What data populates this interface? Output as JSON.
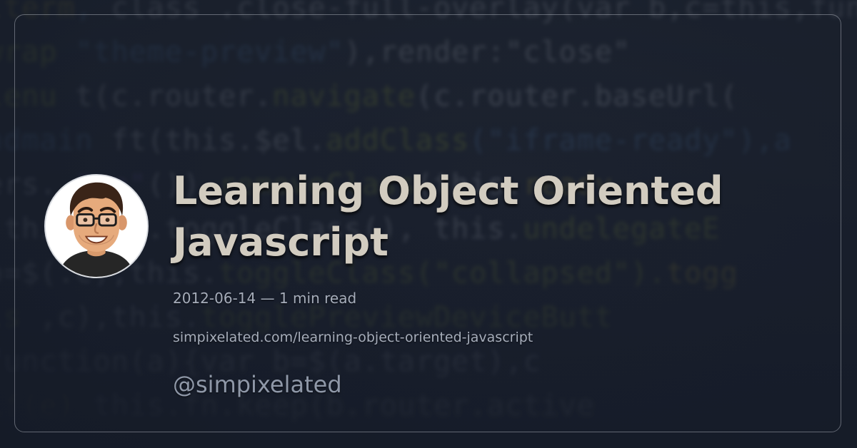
{
  "post": {
    "title": "Learning Object Oriented Javascript",
    "date": "2012-06-14",
    "separator": "—",
    "read_time": "1 min read",
    "url": "simpixelated.com/learning-object-oriented-javascript",
    "handle": "@simpixelated"
  },
  "avatar": {
    "icon": "cartoon-portrait-icon"
  },
  "colors": {
    "title": "#d2ccc0",
    "meta": "#a6adba",
    "handle": "#8f98a8",
    "border": "#bec3cd",
    "background": "#1b2130"
  }
}
